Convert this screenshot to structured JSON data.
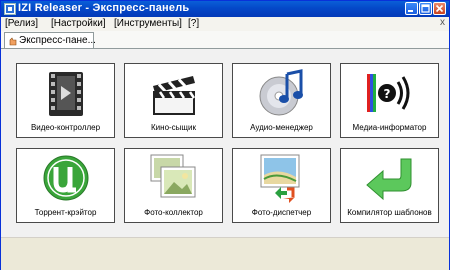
{
  "window": {
    "title": "IZI Releaser - Экспресс-панель"
  },
  "menu": {
    "items": [
      "[Релиз]",
      "[Настройки]",
      "[Инструменты]",
      "[?]"
    ],
    "close": "x"
  },
  "tab": {
    "label": "Экспресс-пане..."
  },
  "tiles": [
    {
      "label": "Видео-контроллер",
      "icon": "film-reel-icon"
    },
    {
      "label": "Кино-сыщик",
      "icon": "clapperboard-icon"
    },
    {
      "label": "Аудио-менеджер",
      "icon": "music-disc-icon"
    },
    {
      "label": "Медиа-информатор",
      "icon": "speaker-info-icon"
    },
    {
      "label": "Торрент-крэйтор",
      "icon": "utorrent-icon"
    },
    {
      "label": "Фото-коллектор",
      "icon": "photo-stack-icon"
    },
    {
      "label": "Фото-диспетчер",
      "icon": "photo-recycle-icon"
    },
    {
      "label": "Компилятор шаблонов",
      "icon": "green-back-arrow-icon"
    }
  ],
  "colors": {
    "title_bar": "#0448c8",
    "tile_border": "#4a4a4a",
    "utorrent_green": "#3aa53a"
  }
}
